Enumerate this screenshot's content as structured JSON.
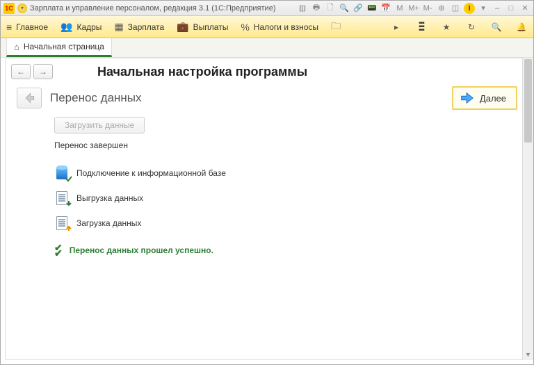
{
  "titlebar": {
    "logo_text": "1C",
    "title": "Зарплата и управление персоналом, редакция 3.1  (1С:Предприятие)"
  },
  "navbar": {
    "main": "Главное",
    "staff": "Кадры",
    "salary": "Зарплата",
    "payments": "Выплаты",
    "taxes": "Налоги и взносы"
  },
  "tabs": {
    "home": "Начальная страница"
  },
  "page": {
    "title": "Начальная настройка программы",
    "step_title": "Перенос данных",
    "next": "Далее",
    "load_button": "Загрузить данные",
    "status": "Перенос завершен"
  },
  "steps": {
    "connect": "Подключение к информационной базе",
    "export": "Выгрузка данных",
    "import": "Загрузка данных",
    "success": "Перенос данных прошел успешно."
  }
}
